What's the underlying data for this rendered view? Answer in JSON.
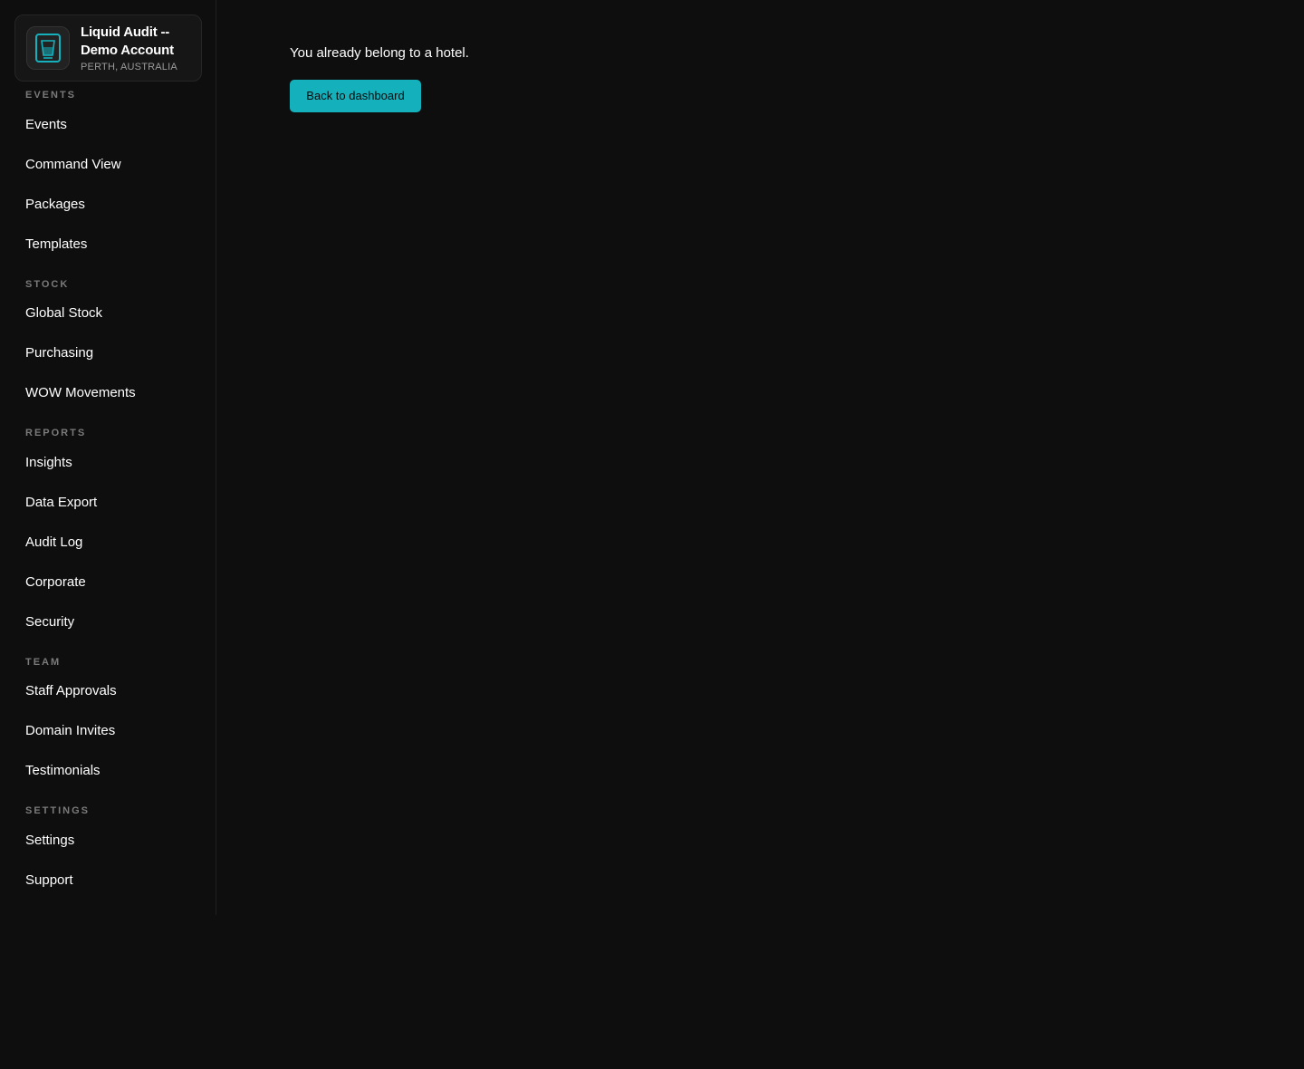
{
  "brand": {
    "name": "Liquid Audit -- Demo Account",
    "location": "PERTH, AUSTRALIA",
    "logo_icon": "glass-icon",
    "accent_color": "#14b1bd"
  },
  "sidebar": {
    "sections": [
      {
        "title": "EVENTS",
        "items": [
          {
            "label": "Events"
          },
          {
            "label": "Command View"
          },
          {
            "label": "Packages"
          },
          {
            "label": "Templates"
          }
        ]
      },
      {
        "title": "STOCK",
        "items": [
          {
            "label": "Global Stock"
          },
          {
            "label": "Purchasing"
          },
          {
            "label": "WOW Movements"
          }
        ]
      },
      {
        "title": "REPORTS",
        "items": [
          {
            "label": "Insights"
          },
          {
            "label": "Data Export"
          },
          {
            "label": "Audit Log"
          },
          {
            "label": "Corporate"
          },
          {
            "label": "Security"
          }
        ]
      },
      {
        "title": "TEAM",
        "items": [
          {
            "label": "Staff Approvals"
          },
          {
            "label": "Domain Invites"
          },
          {
            "label": "Testimonials"
          }
        ]
      },
      {
        "title": "SETTINGS",
        "items": [
          {
            "label": "Settings"
          },
          {
            "label": "Support"
          }
        ]
      }
    ]
  },
  "main": {
    "message": "You already belong to a hotel.",
    "back_button_label": "Back to dashboard"
  }
}
